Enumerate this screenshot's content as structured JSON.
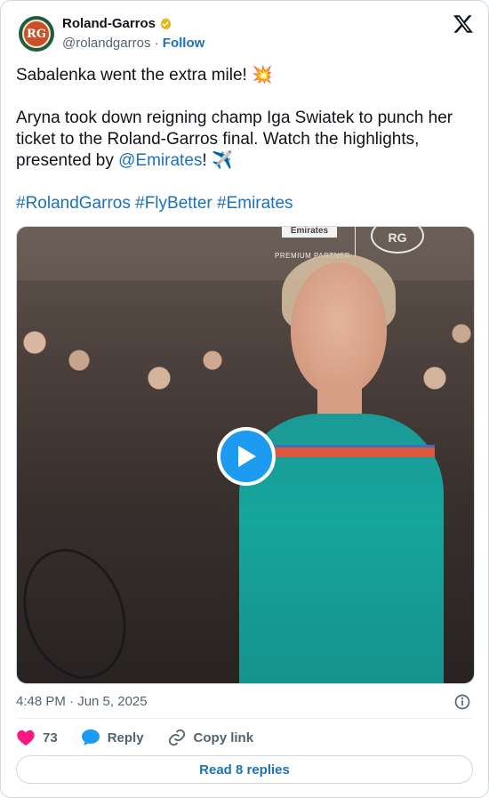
{
  "author": {
    "display_name": "Roland-Garros",
    "handle": "@rolandgarros",
    "separator": "·",
    "follow_label": "Follow",
    "avatar_initials": "RG"
  },
  "tweet": {
    "line1": "Sabalenka went the extra mile! 💥",
    "line2_part1": "Aryna took down reigning champ Iga Swiatek to punch her ticket to the Roland-Garros final. Watch the highlights, presented by ",
    "mention": "@Emirates",
    "line2_part2": "! ✈️",
    "hashtags": [
      "#RolandGarros",
      "#FlyBetter",
      "#Emirates"
    ]
  },
  "media": {
    "sponsor_brand": "Emirates",
    "sponsor_label": "PREMIUM PARTNER",
    "logo_text": "RG"
  },
  "timestamp": "4:48 PM · Jun 5, 2025",
  "actions": {
    "likes": "73",
    "reply_label": "Reply",
    "copy_label": "Copy link"
  },
  "read_replies_label": "Read 8 replies",
  "colors": {
    "link": "#1d71b8",
    "like": "#f91880",
    "reply_icon": "#1d9bf0",
    "play": "#1d9bf0"
  }
}
